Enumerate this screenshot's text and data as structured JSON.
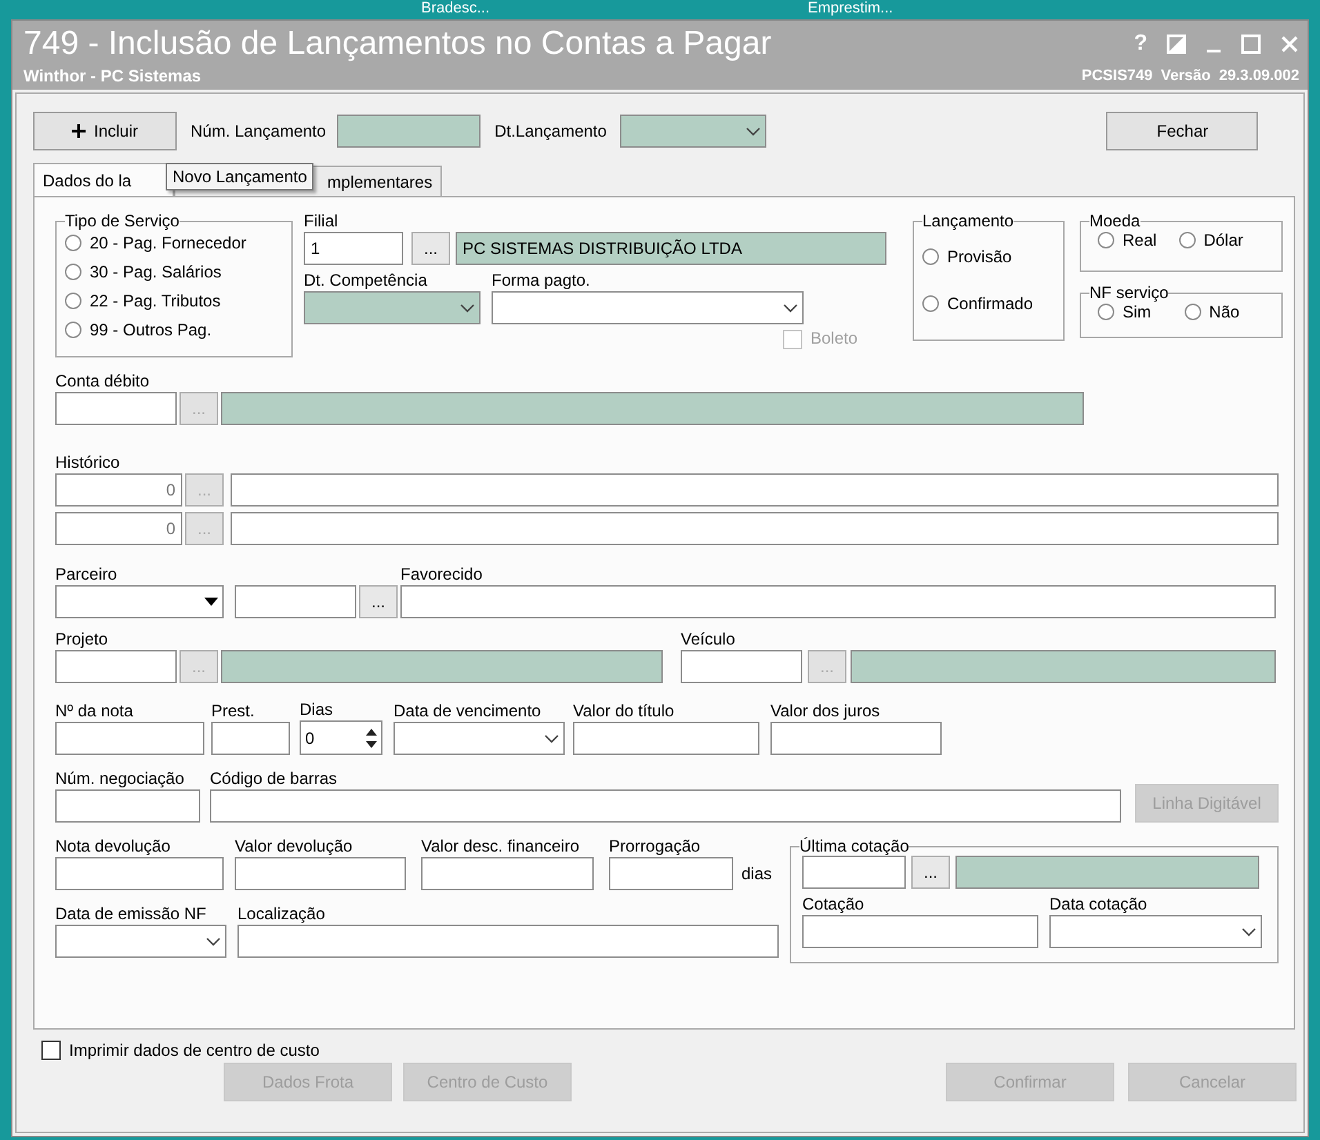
{
  "taskbar": [
    {
      "label": "Bradesc..."
    },
    {
      "label": "Emprestim..."
    }
  ],
  "window": {
    "title": "749 - Inclusão de Lançamentos no Contas a Pagar",
    "subtitle": "Winthor - PC Sistemas",
    "routine": "PCSIS749",
    "version_label": "Versão",
    "version": "29.3.09.002",
    "help": "?"
  },
  "toolbar": {
    "add_button": "Incluir",
    "tooltip": "Novo Lançamento",
    "num_label": "Núm. Lançamento",
    "date_label": "Dt.Lançamento",
    "close_button": "Fechar"
  },
  "tabs": [
    {
      "label": "Dados do la",
      "selected": true
    },
    {
      "label": "mplementares",
      "selected": false
    }
  ],
  "tipo_servico": {
    "title": "Tipo de Serviço",
    "options": [
      {
        "label": "20 - Pag. Fornecedor",
        "selected": false
      },
      {
        "label": "30 - Pag. Salários",
        "selected": false
      },
      {
        "label": "22 - Pag. Tributos",
        "selected": false
      },
      {
        "label": "99 - Outros Pag.",
        "selected": false
      }
    ]
  },
  "filial": {
    "label": "Filial",
    "code": "1",
    "button": "...",
    "name": "PC SISTEMAS DISTRIBUIÇÃO LTDA"
  },
  "dt_competencia": {
    "label": "Dt. Competência"
  },
  "forma_pagto": {
    "label": "Forma pagto."
  },
  "boleto": {
    "label": "Boleto",
    "checked": false,
    "disabled": true
  },
  "lancamento": {
    "title": "Lançamento",
    "options": [
      {
        "label": "Provisão",
        "selected": false
      },
      {
        "label": "Confirmado",
        "selected": false
      }
    ]
  },
  "moeda": {
    "title": "Moeda",
    "options": [
      {
        "label": "Real",
        "selected": false
      },
      {
        "label": "Dólar",
        "selected": false
      }
    ]
  },
  "nf_servico": {
    "title": "NF serviço",
    "options": [
      {
        "label": "Sim",
        "selected": false
      },
      {
        "label": "Não",
        "selected": false
      }
    ]
  },
  "conta_debito": {
    "label": "Conta débito",
    "button": "...",
    "disabled": true
  },
  "historico": {
    "label": "Histórico",
    "rows": [
      {
        "code": "0",
        "button": "..."
      },
      {
        "code": "0",
        "button": "..."
      }
    ]
  },
  "parceiro": {
    "label": "Parceiro"
  },
  "favorecido": {
    "label": "Favorecido",
    "button": "..."
  },
  "projeto": {
    "label": "Projeto",
    "button": "..."
  },
  "veiculo": {
    "label": "Veículo",
    "button": "..."
  },
  "nota_fields": [
    {
      "label": "Nº da nota",
      "kind": "text"
    },
    {
      "label": "Prest.",
      "kind": "text"
    },
    {
      "label": "Dias",
      "kind": "spin",
      "value": "0"
    },
    {
      "label": "Data de vencimento",
      "kind": "date"
    },
    {
      "label": "Valor do título",
      "kind": "text"
    },
    {
      "label": "Valor dos juros",
      "kind": "text"
    }
  ],
  "negociacao_fields": [
    {
      "label": "Núm. negociação",
      "kind": "text"
    },
    {
      "label": "Código de barras",
      "kind": "text"
    }
  ],
  "linha_digitavel": {
    "label": "Linha Digitável",
    "disabled": true
  },
  "devolucao_fields": [
    {
      "label": "Nota devolução",
      "kind": "text"
    },
    {
      "label": "Valor devolução",
      "kind": "text"
    },
    {
      "label": "Valor desc. financeiro",
      "kind": "text"
    },
    {
      "label": "Prorrogação",
      "kind": "text"
    }
  ],
  "dias_suffix": "dias",
  "emissao_fields": [
    {
      "label": "Data de emissão NF",
      "kind": "date"
    },
    {
      "label": "Localização",
      "kind": "text"
    }
  ],
  "ultima_cotacao": {
    "title": "Última cotação",
    "button": "...",
    "cotacao_label": "Cotação",
    "data_label": "Data cotação"
  },
  "print_cost_center": {
    "label": "Imprimir dados de centro de custo",
    "checked": false
  },
  "footer_buttons": [
    {
      "label": "Dados Frota",
      "disabled": true
    },
    {
      "label": "Centro de Custo",
      "disabled": true
    },
    {
      "label": "Confirmar",
      "disabled": true
    },
    {
      "label": "Cancelar",
      "disabled": true
    }
  ]
}
